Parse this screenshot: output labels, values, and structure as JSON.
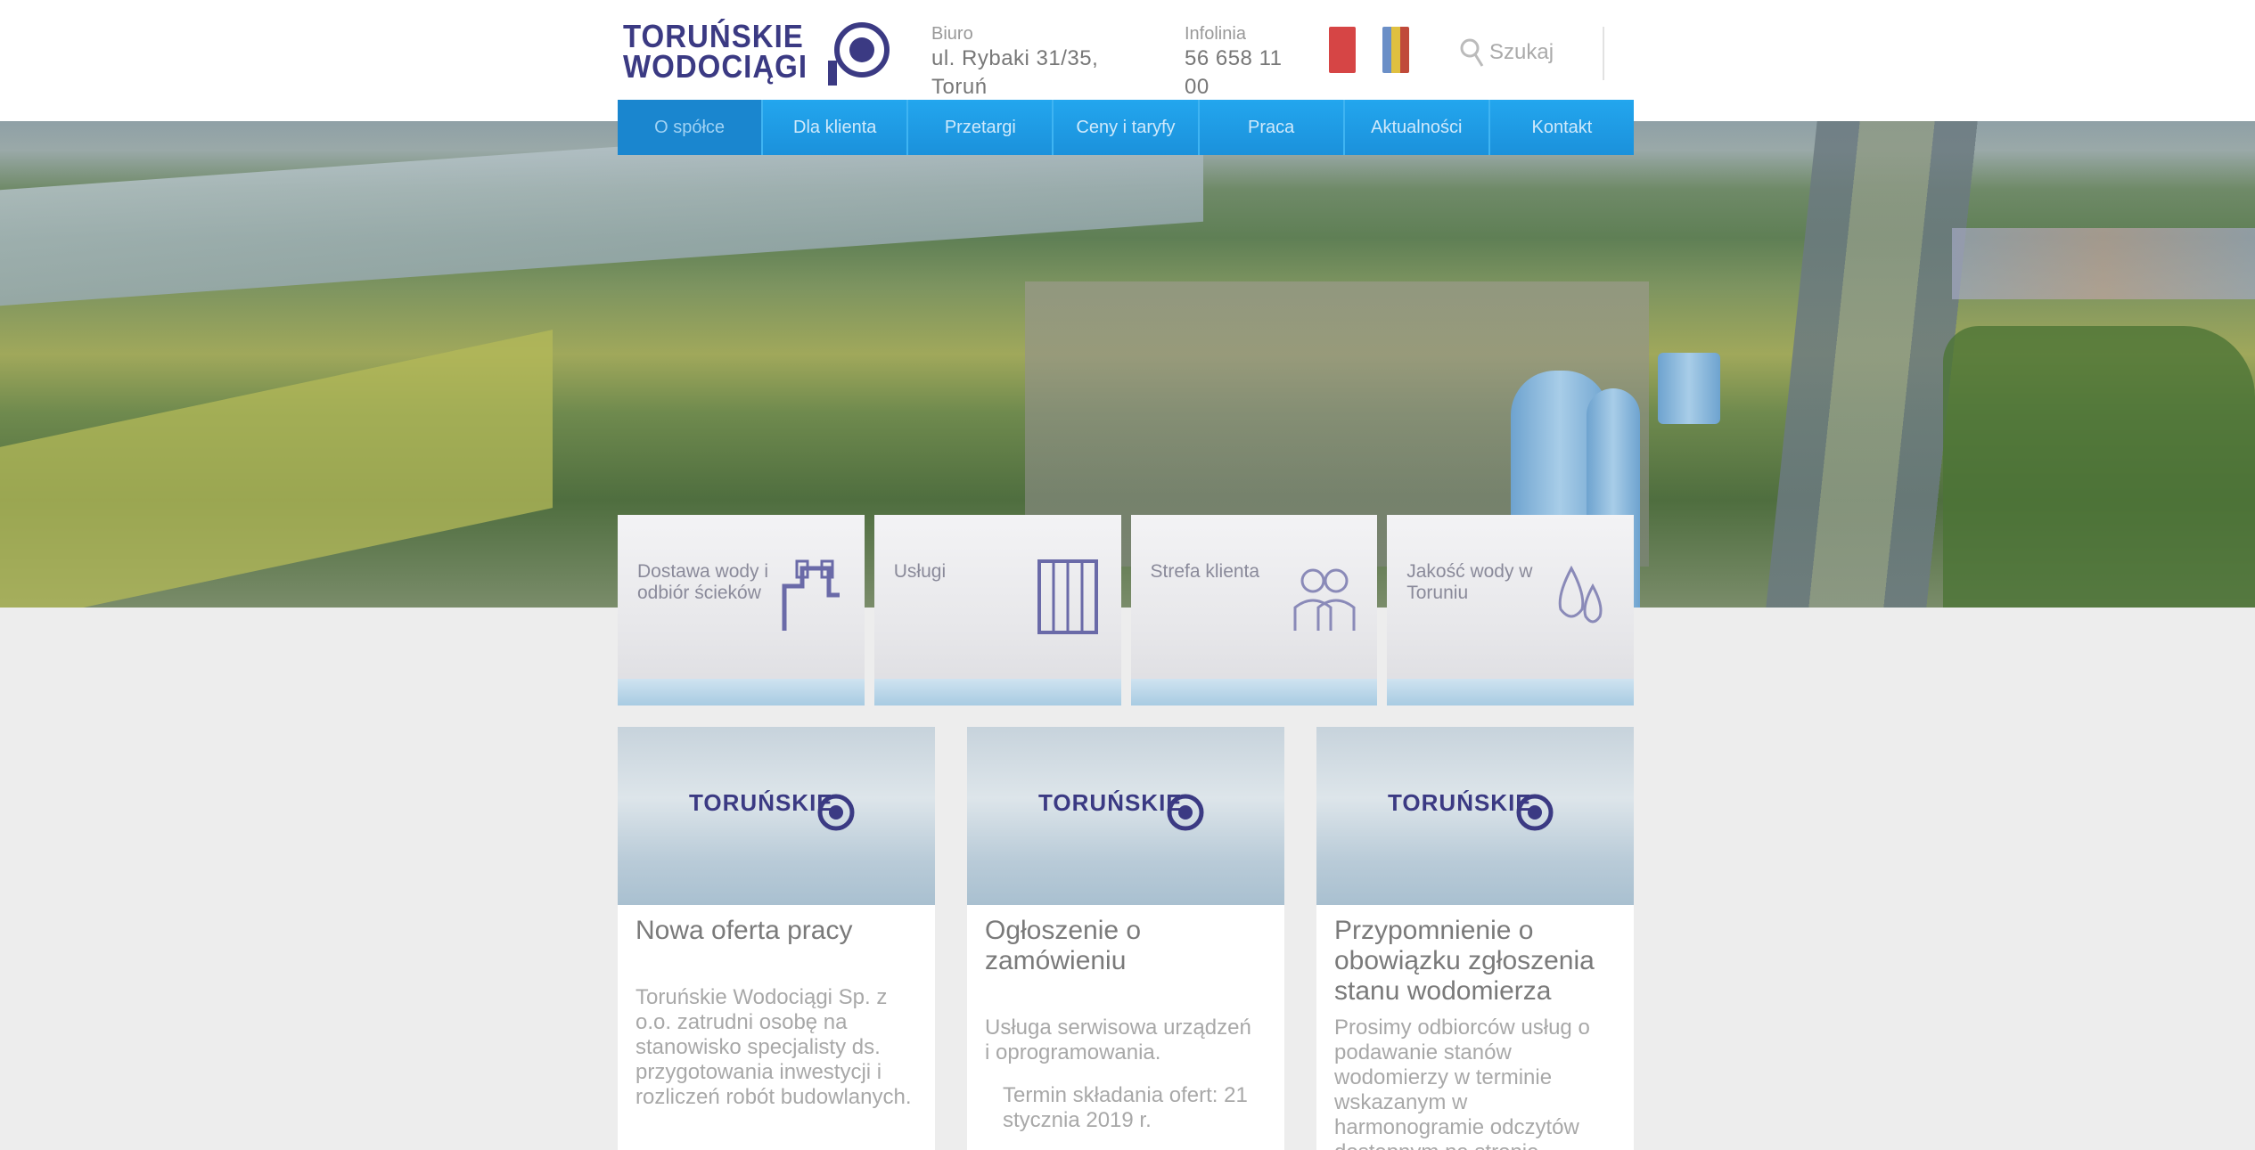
{
  "header": {
    "logo_line_1": "TORUŃSKIE",
    "logo_line_2": "WODOCIĄGI",
    "contact_1_label": "Biuro",
    "contact_1_value": "ul. Rybaki 31/35, Toruń",
    "contact_2_label": "Infolinia",
    "contact_2_value": "56 658 11 00",
    "search_placeholder": "Szukaj"
  },
  "nav": {
    "items": [
      "O spółce",
      "Dla klienta",
      "Przetargi",
      "Ceny i taryfy",
      "Praca",
      "Aktualności",
      "Kontakt"
    ]
  },
  "services": [
    {
      "label": "Dostawa wody i odbiór ścieków"
    },
    {
      "label": "Usługi"
    },
    {
      "label": "Strefa klienta"
    },
    {
      "label": "Jakość wody w Toruniu"
    }
  ],
  "news": [
    {
      "title": "Nowa oferta pracy",
      "text": "Toruńskie Wodociągi Sp. z o.o. zatrudni osobę na stanowisko specjalisty ds. przygotowania inwestycji i rozliczeń robót budowlanych."
    },
    {
      "title": "Ogłoszenie o zamówieniu",
      "text": "Usługa serwisowa urządzeń i oprogramowania.",
      "sub": "Termin składania ofert: 21 stycznia 2019 r."
    },
    {
      "title": "Przypomnienie o obowiązku zgłoszenia stanu wodomierza",
      "text": "Prosimy odbiorców usług o podawanie stanów wodomierzy w terminie wskazanym w harmonogramie odczytów dostępnym na stronie."
    }
  ]
}
